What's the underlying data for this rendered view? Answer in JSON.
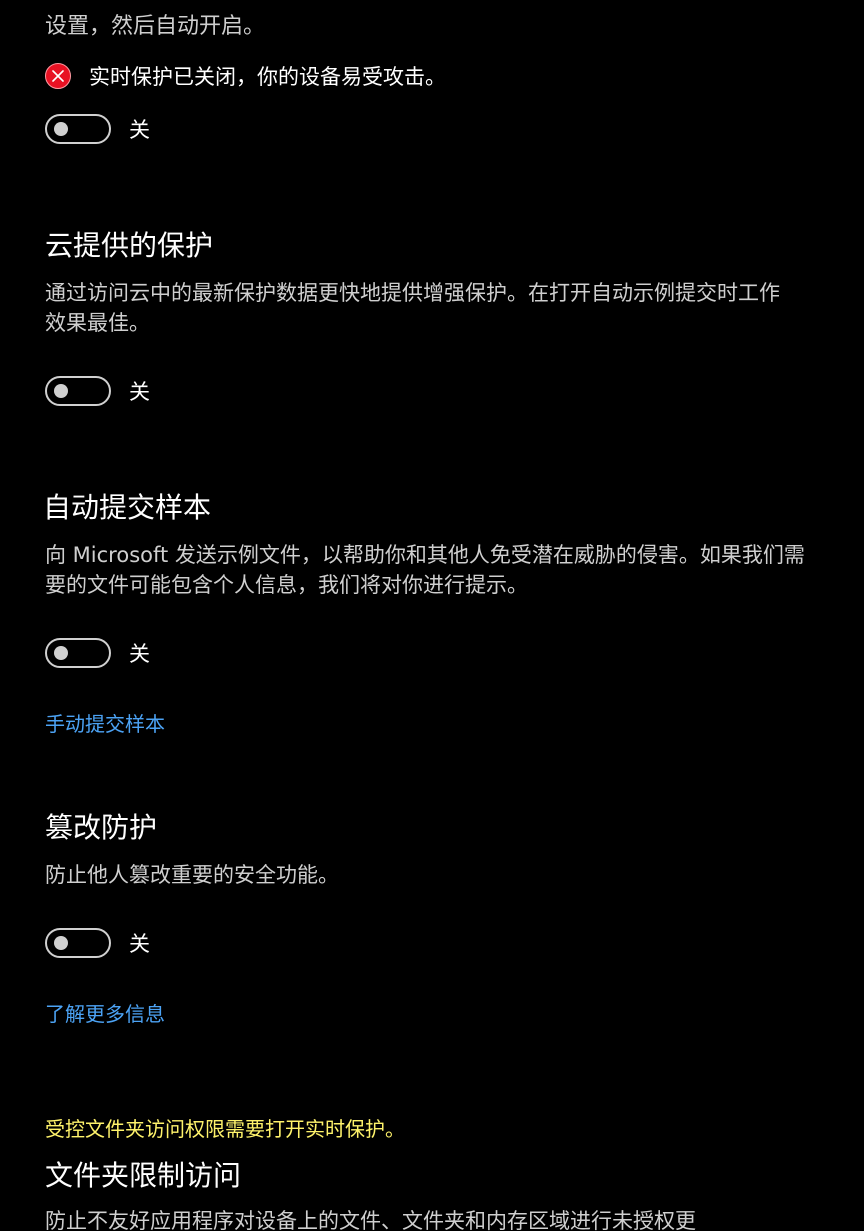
{
  "colors": {
    "background": "#000000",
    "text_primary": "#ffffff",
    "text_secondary": "#cfcfcf",
    "link": "#4ca3f5",
    "warning": "#fff36b",
    "error": "#e81123"
  },
  "top": {
    "cut_text": "设置，然后自动开启。",
    "alert_icon": "error-circle-x-icon",
    "alert_text": "实时保护已关闭，你的设备易受攻击。",
    "toggle_state": "关"
  },
  "cloud_protection": {
    "title": "云提供的保护",
    "description": "通过访问云中的最新保护数据更快地提供增强保护。在打开自动示例提交时工作效果最佳。",
    "toggle_state": "关"
  },
  "auto_sample": {
    "title": "自动提交样本",
    "description": "向 Microsoft 发送示例文件，以帮助你和其他人免受潜在威胁的侵害。如果我们需要的文件可能包含个人信息，我们将对你进行提示。",
    "toggle_state": "关",
    "link": "手动提交样本"
  },
  "tamper": {
    "title": "篡改防护",
    "description": "防止他人篡改重要的安全功能。",
    "toggle_state": "关",
    "link": "了解更多信息"
  },
  "folder_access": {
    "warning": "受控文件夹访问权限需要打开实时保护。",
    "title": "文件夹限制访问",
    "description": "防止不友好应用程序对设备上的文件、文件夹和内存区域进行未授权更"
  }
}
